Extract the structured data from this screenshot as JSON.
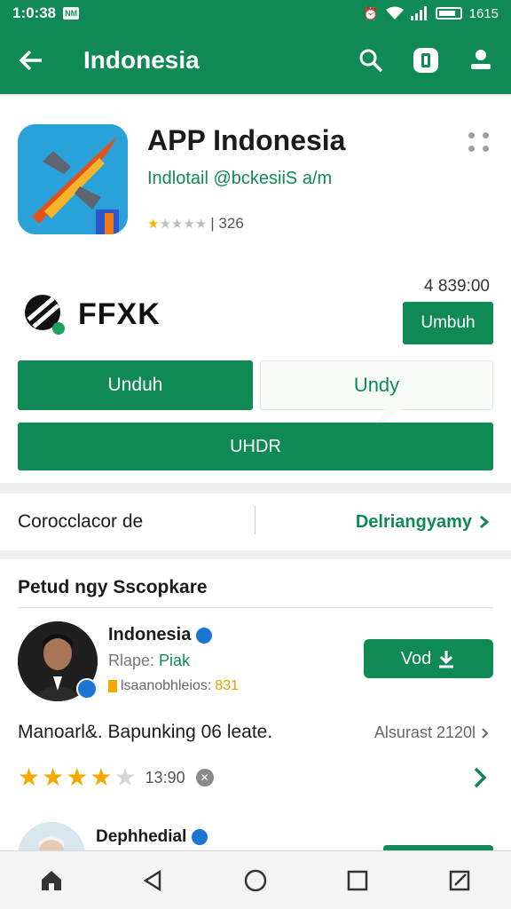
{
  "status_bar": {
    "time": "1:0:38",
    "notif": "NM",
    "battery_text": "1615"
  },
  "app_bar": {
    "title": "Indonesia"
  },
  "app": {
    "name": "APP Indonesia",
    "developer": "Indlotail @bckesiiS a/m",
    "rating_text": "| 326",
    "rating_stars": 1
  },
  "promo": {
    "brand": "FFXK",
    "price": "4 839:00",
    "small_button": "Umbuh",
    "button_primary": "Unduh",
    "button_secondary": "Undy",
    "button_wide": "UHDR"
  },
  "info_row": {
    "left": "Corocclacor de",
    "right": "Delriangyamy"
  },
  "reviews": {
    "section_title": "Petud ngy Sscopkare",
    "items": [
      {
        "name": "Indonesia",
        "sub_prefix": "Rlape:",
        "sub_highlight": "Piak",
        "meta_prefix": "lsaanobhleios:",
        "meta_highlight": "831",
        "button": "Vod",
        "text": "Manoarl&. Bapunking 06 leate.",
        "date": "Alsurast 2120l",
        "stars": 4,
        "count": "13:90"
      },
      {
        "name": "Dephhedial"
      }
    ]
  }
}
